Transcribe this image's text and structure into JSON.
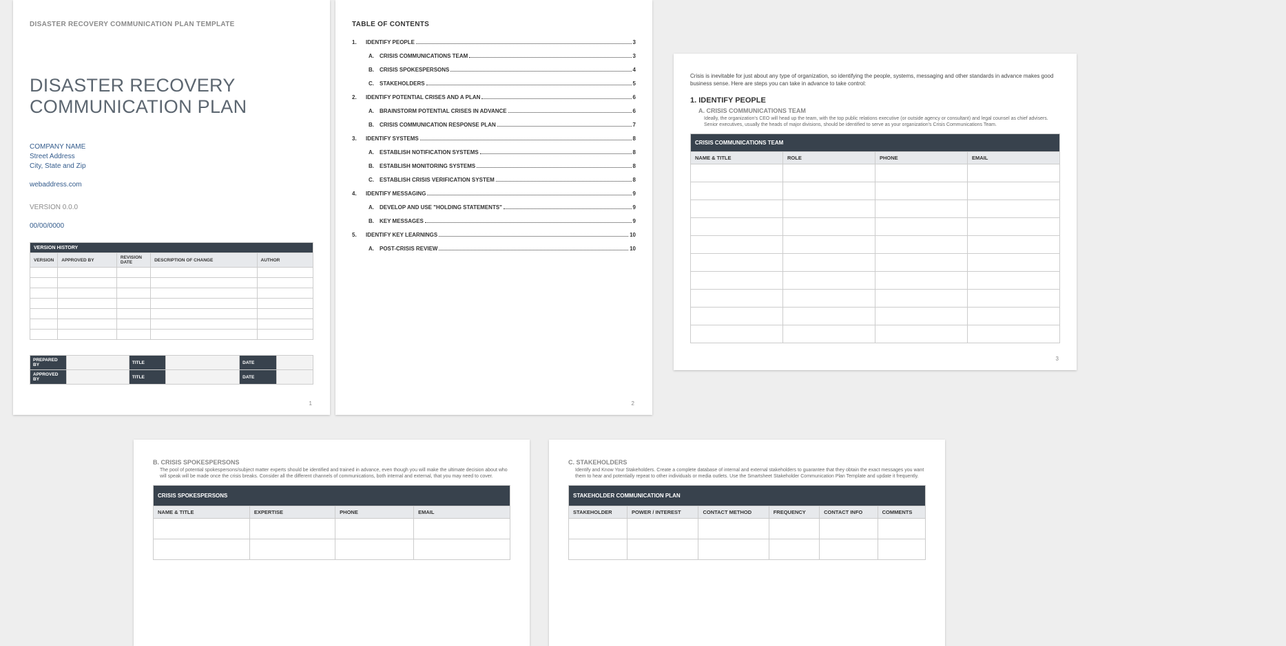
{
  "page1": {
    "template_header": "DISASTER RECOVERY COMMUNICATION PLAN TEMPLATE",
    "title_line1": "DISASTER RECOVERY",
    "title_line2": "COMMUNICATION PLAN",
    "company_name": "COMPANY NAME",
    "street": "Street Address",
    "city_state_zip": "City, State and Zip",
    "web": "webaddress.com",
    "version": "VERSION 0.0.0",
    "date": "00/00/0000",
    "version_history": {
      "title": "VERSION HISTORY",
      "headers": [
        "VERSION",
        "APPROVED BY",
        "REVISION DATE",
        "DESCRIPTION OF CHANGE",
        "AUTHOR"
      ],
      "rows": 7
    },
    "sig": {
      "rows": [
        [
          "PREPARED BY",
          "TITLE",
          "DATE"
        ],
        [
          "APPROVED BY",
          "TITLE",
          "DATE"
        ]
      ]
    },
    "page_number": "1"
  },
  "page2": {
    "toc_title": "TABLE OF CONTENTS",
    "items": [
      {
        "num": "1.",
        "sub": "",
        "label": "IDENTIFY PEOPLE",
        "pg": "3"
      },
      {
        "num": "",
        "sub": "A.",
        "label": "CRISIS COMMUNICATIONS TEAM",
        "pg": "3"
      },
      {
        "num": "",
        "sub": "B.",
        "label": "CRISIS SPOKESPERSONS",
        "pg": "4"
      },
      {
        "num": "",
        "sub": "C.",
        "label": "STAKEHOLDERS",
        "pg": "5"
      },
      {
        "num": "2.",
        "sub": "",
        "label": "IDENTIFY POTENTIAL CRISES AND A PLAN",
        "pg": "6"
      },
      {
        "num": "",
        "sub": "A.",
        "label": "BRAINSTORM POTENTIAL CRISES IN ADVANCE",
        "pg": "6"
      },
      {
        "num": "",
        "sub": "B.",
        "label": "CRISIS COMMUNICATION RESPONSE PLAN",
        "pg": "7"
      },
      {
        "num": "3.",
        "sub": "",
        "label": "IDENTIFY SYSTEMS",
        "pg": "8"
      },
      {
        "num": "",
        "sub": "A.",
        "label": "ESTABLISH NOTIFICATION SYSTEMS",
        "pg": "8"
      },
      {
        "num": "",
        "sub": "B.",
        "label": "ESTABLISH MONITORING SYSTEMS",
        "pg": "8"
      },
      {
        "num": "",
        "sub": "C.",
        "label": "ESTABLISH CRISIS VERIFICATION SYSTEM",
        "pg": "8"
      },
      {
        "num": "4.",
        "sub": "",
        "label": "IDENTIFY MESSAGING",
        "pg": "9"
      },
      {
        "num": "",
        "sub": "A.",
        "label": "DEVELOP AND USE \"HOLDING STATEMENTS\"",
        "pg": "9"
      },
      {
        "num": "",
        "sub": "B.",
        "label": "KEY MESSAGES",
        "pg": "9"
      },
      {
        "num": "5.",
        "sub": "",
        "label": "IDENTIFY KEY LEARNINGS",
        "pg": "10"
      },
      {
        "num": "",
        "sub": "A.",
        "label": "POST-CRISIS REVIEW",
        "pg": "10"
      }
    ],
    "page_number": "2"
  },
  "page3": {
    "intro": "Crisis is inevitable for just about any type of organization, so identifying the people, systems, messaging and other standards in advance makes good business sense. Here are steps you can take in advance to take control:",
    "heading": "1. IDENTIFY PEOPLE",
    "sub_heading": "A. CRISIS COMMUNICATIONS TEAM",
    "sub_desc": "Ideally, the organization's CEO will head up the team, with the top public relations executive (or outside agency or consultant) and legal counsel as chief advisers. Senior executives, usually the heads of major divisions, should be identified to serve as your organization's Crisis Communications Team.",
    "table_title": "CRISIS COMMUNICATIONS TEAM",
    "headers": [
      "NAME & TITLE",
      "ROLE",
      "PHONE",
      "EMAIL"
    ],
    "rows": 10,
    "page_number": "3"
  },
  "page4": {
    "sub_heading": "B. CRISIS SPOKESPERSONS",
    "sub_desc": "The pool of potential spokespersons/subject matter experts should be identified and trained in advance, even though you will make the ultimate decision about who will speak will be made once the crisis breaks. Consider all the different channels of communications, both internal and external, that you may need to cover.",
    "table_title": "CRISIS SPOKESPERSONS",
    "headers": [
      "NAME & TITLE",
      "EXPERTISE",
      "PHONE",
      "EMAIL"
    ],
    "rows": 2
  },
  "page5": {
    "sub_heading": "C. STAKEHOLDERS",
    "sub_desc": "Identify and Know Your Stakeholders. Create a complete database of internal and external stakeholders to guarantee that they obtain the exact messages you want them to hear and potentially repeat to other individuals or media outlets. Use the Smartsheet Stakeholder Communication Plan Template and update it frequently.",
    "table_title": "STAKEHOLDER COMMUNICATION PLAN",
    "headers": [
      "STAKEHOLDER",
      "POWER / INTEREST",
      "CONTACT METHOD",
      "FREQUENCY",
      "CONTACT INFO",
      "COMMENTS"
    ],
    "rows": 2
  }
}
